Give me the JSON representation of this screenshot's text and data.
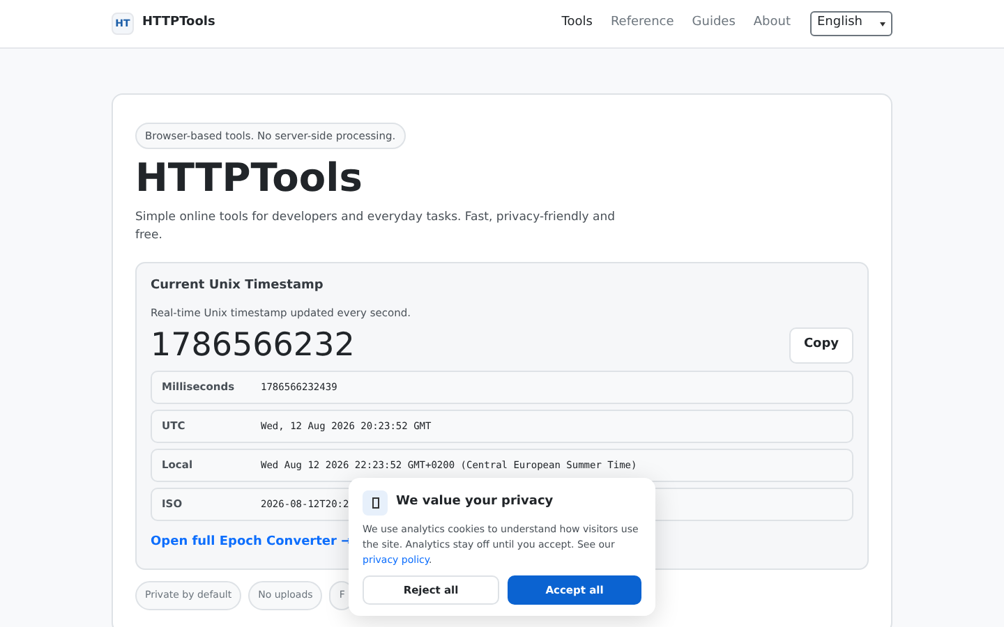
{
  "header": {
    "logo": "HT",
    "brand": "HTTPTools",
    "nav": [
      {
        "label": "Tools",
        "selected": true
      },
      {
        "label": "Reference",
        "selected": false
      },
      {
        "label": "Guides",
        "selected": false
      },
      {
        "label": "About",
        "selected": false
      }
    ],
    "language": "English"
  },
  "hero": {
    "badge": "Browser-based tools. No server-side processing.",
    "title": "HTTPTools",
    "subtitle": "Simple online tools for developers and everyday tasks. Fast, privacy-friendly and free."
  },
  "timestamp": {
    "title": "Current Unix Timestamp",
    "description": "Real-time Unix timestamp updated every second.",
    "value": "1786566232",
    "copy": "Copy",
    "rows": [
      {
        "label": "Milliseconds",
        "value": "1786566232439"
      },
      {
        "label": "UTC",
        "value": "Wed, 12 Aug 2026 20:23:52 GMT"
      },
      {
        "label": "Local",
        "value": "Wed Aug 12 2026 22:23:52 GMT+0200 (Central European Summer Time)"
      },
      {
        "label": "ISO",
        "value": "2026-08-12T20:2"
      }
    ],
    "link": "Open full Epoch Converter →"
  },
  "chips": [
    "Private by default",
    "No uploads",
    "F"
  ],
  "cookie_banner": {
    "title": "We value your privacy",
    "text": "We use analytics cookies to understand how visitors use the site. Analytics stay off until you accept. See our ",
    "link": "privacy policy",
    "text_end": ".",
    "reject": "Reject all",
    "accept": "Accept all"
  }
}
